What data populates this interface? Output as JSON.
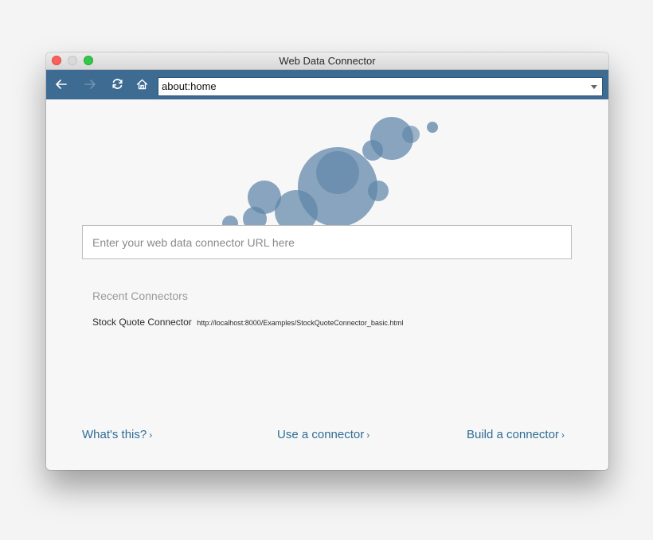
{
  "window": {
    "title": "Web Data Connector"
  },
  "toolbar": {
    "back_icon": "arrow-left-icon",
    "forward_icon": "arrow-right-icon",
    "reload_icon": "reload-icon",
    "home_icon": "home-icon",
    "address": "about:home",
    "color": "#3e6b91"
  },
  "main": {
    "url_placeholder": "Enter your web data connector URL here",
    "recent_heading": "Recent Connectors",
    "recent": [
      {
        "name": "Stock Quote Connector",
        "url": "http://localhost:8000/Examples/StockQuoteConnector_basic.html"
      }
    ]
  },
  "footer": {
    "whats_this": "What's this?",
    "use_connector": "Use a connector",
    "build_connector": "Build a connector",
    "chevron": "›",
    "link_color": "#2f6d95"
  },
  "bubble_color": "#5d84a7"
}
